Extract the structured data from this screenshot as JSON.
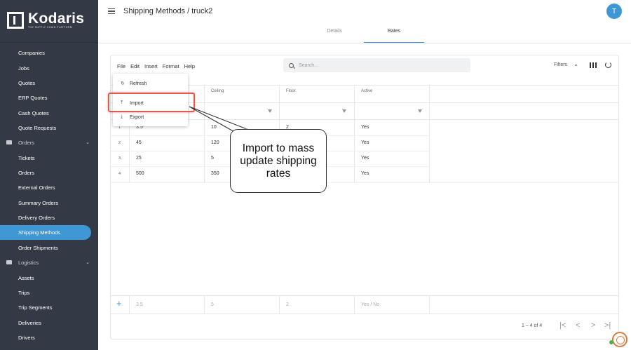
{
  "brand": {
    "name": "Kodaris",
    "tagline": "THE SUPPLY CHAIN PLATFORM"
  },
  "sidebar": {
    "items": [
      {
        "label": "Companies",
        "type": "item"
      },
      {
        "label": "Jobs",
        "type": "item"
      },
      {
        "label": "Quotes",
        "type": "item"
      },
      {
        "label": "ERP Quotes",
        "type": "item"
      },
      {
        "label": "Cash Quotes",
        "type": "item"
      },
      {
        "label": "Quote Requests",
        "type": "item"
      },
      {
        "label": "Orders",
        "type": "section"
      },
      {
        "label": "Tickets",
        "type": "item"
      },
      {
        "label": "Orders",
        "type": "item"
      },
      {
        "label": "External Orders",
        "type": "item"
      },
      {
        "label": "Summary Orders",
        "type": "item"
      },
      {
        "label": "Delivery Orders",
        "type": "item"
      },
      {
        "label": "Shipping Methods",
        "type": "item",
        "active": true
      },
      {
        "label": "Order Shipments",
        "type": "item"
      },
      {
        "label": "Logistics",
        "type": "section"
      },
      {
        "label": "Assets",
        "type": "item"
      },
      {
        "label": "Trips",
        "type": "item"
      },
      {
        "label": "Trip Segments",
        "type": "item"
      },
      {
        "label": "Deliveries",
        "type": "item"
      },
      {
        "label": "Drivers",
        "type": "item"
      }
    ]
  },
  "header": {
    "title": "Shipping Methods / truck2",
    "avatar_letter": "T",
    "tabs": [
      {
        "label": "Details"
      },
      {
        "label": "Rates",
        "active": true
      }
    ]
  },
  "toolbar": {
    "menu": [
      "File",
      "Edit",
      "Insert",
      "Format",
      "Help"
    ],
    "search_placeholder": "Search...",
    "filters_label": "Filters"
  },
  "grid": {
    "columns": [
      "Ceiling",
      "Floor",
      "Active"
    ],
    "rows": [
      {
        "num": "1",
        "c0": "3.5",
        "c1": "10",
        "c2": "2",
        "c3": "Yes"
      },
      {
        "num": "2",
        "c0": "45",
        "c1": "120",
        "c2": "",
        "c3": "Yes"
      },
      {
        "num": "3",
        "c0": "25",
        "c1": "5",
        "c2": "",
        "c3": "Yes"
      },
      {
        "num": "4",
        "c0": "500",
        "c1": "350",
        "c2": "",
        "c3": "Yes"
      }
    ],
    "new_row": {
      "c0": "3.5",
      "c1": "5",
      "c2": "2",
      "c3": "Yes / No"
    },
    "pagination": "1 – 4 of 4"
  },
  "file_menu": {
    "items": [
      {
        "label": "Refresh",
        "icon": "refresh-icon"
      },
      {
        "label": "Import",
        "icon": "upload-icon"
      },
      {
        "label": "Export",
        "icon": "download-icon"
      }
    ]
  },
  "callout": {
    "text": "Import to mass update shipping rates"
  },
  "colors": {
    "sidebar_bg": "#333a45",
    "accent": "#3f97d6",
    "highlight": "#e05a4e"
  }
}
